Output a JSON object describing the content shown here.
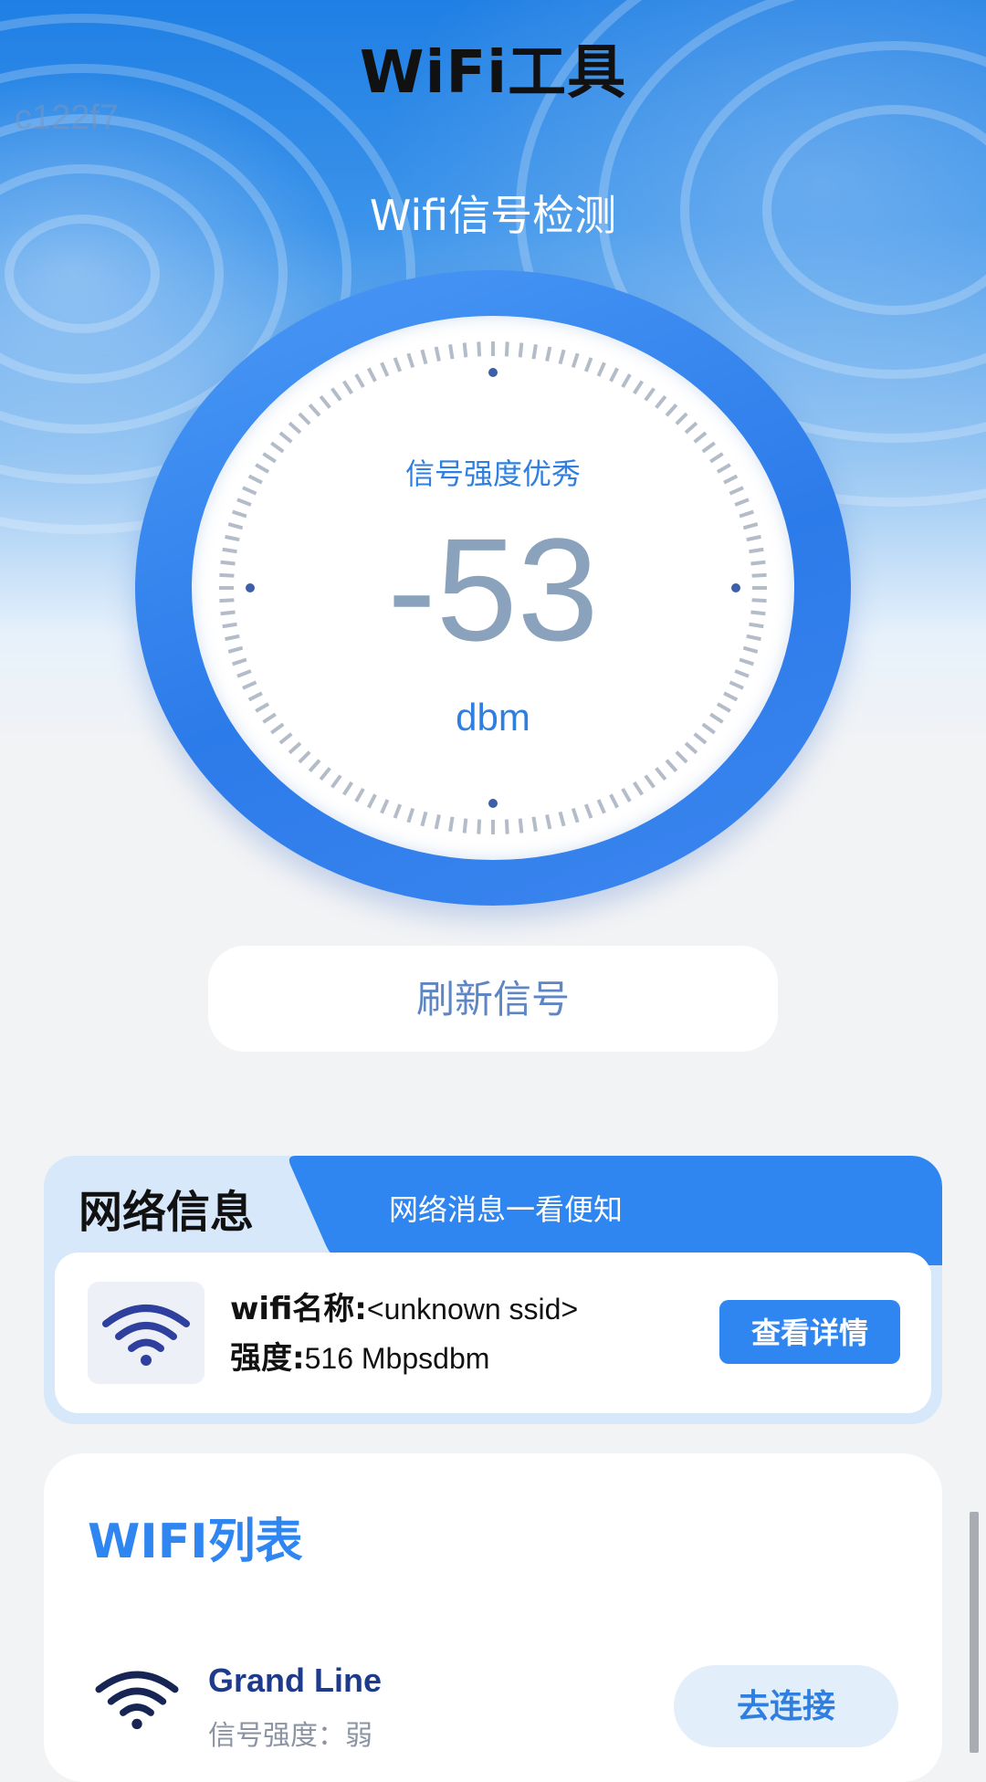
{
  "header": {
    "title": "WiFi工具",
    "watermark": "c122f7",
    "subtitle": "Wifi信号检测"
  },
  "gauge": {
    "status_label": "信号强度优秀",
    "value": "-53",
    "unit": "dbm"
  },
  "refresh_button": {
    "label": "刷新信号"
  },
  "network_info": {
    "title": "网络信息",
    "subtitle": "网络消息一看便知",
    "name_label": "wifi名称:",
    "name_value": "<unknown ssid>",
    "strength_label": "强度:",
    "strength_value": "516 Mbpsdbm",
    "detail_button": "查看详情",
    "icon": "wifi-icon"
  },
  "wifi_list": {
    "title": "WIFI列表",
    "items": [
      {
        "name": "Grand Line",
        "strength": "信号强度：弱",
        "action": "去连接",
        "icon": "wifi-icon"
      }
    ]
  },
  "colors": {
    "accent": "#2f86f0",
    "title_blue": "#2f7fe0",
    "gauge_value": "#8aa2bb",
    "dark_navy": "#1e3a8a"
  }
}
